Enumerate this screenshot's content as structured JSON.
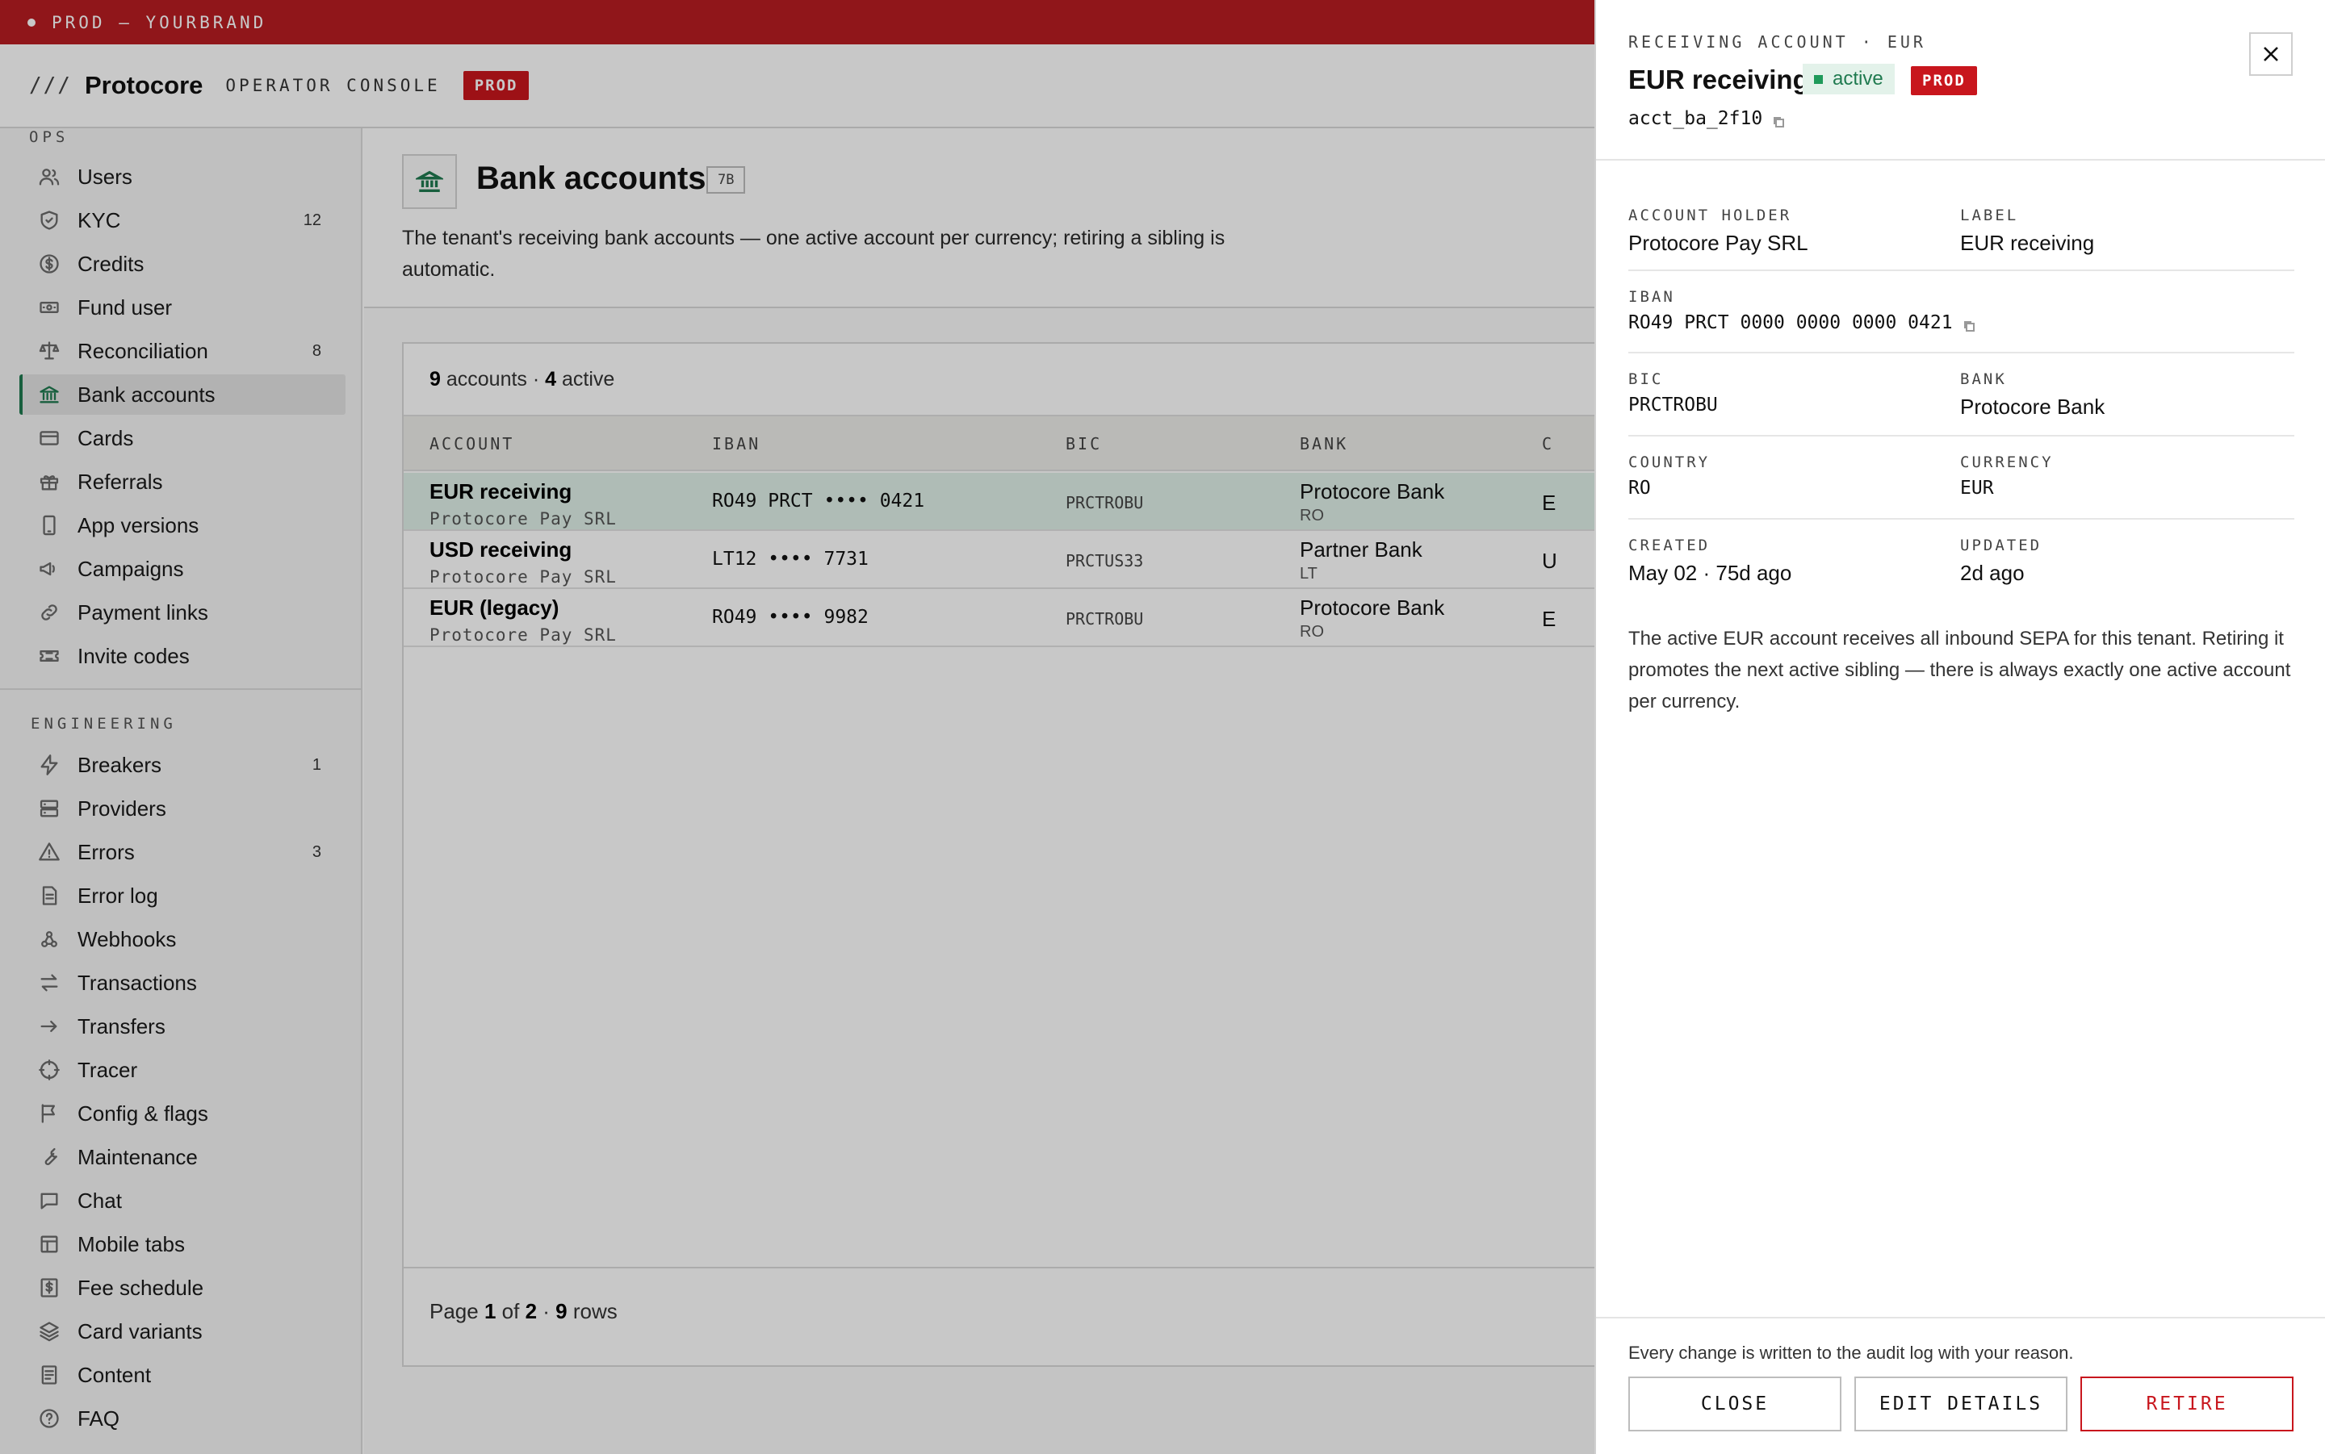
{
  "env_bar": {
    "label": "PROD — YOURBRAND"
  },
  "header": {
    "slashes": "///",
    "brand": "Protocore",
    "console": "OPERATOR CONSOLE",
    "badge": "PROD"
  },
  "sidebar": {
    "ops_label": "OPS",
    "ops_items": [
      {
        "label": "Users",
        "icon": "users-icon",
        "count": ""
      },
      {
        "label": "KYC",
        "icon": "shield-icon",
        "count": "12"
      },
      {
        "label": "Credits",
        "icon": "dollar-circle-icon",
        "count": ""
      },
      {
        "label": "Fund user",
        "icon": "banknote-icon",
        "count": ""
      },
      {
        "label": "Reconciliation",
        "icon": "scale-icon",
        "count": "8"
      },
      {
        "label": "Bank accounts",
        "icon": "bank-icon",
        "count": "",
        "active": true
      },
      {
        "label": "Cards",
        "icon": "card-icon",
        "count": ""
      },
      {
        "label": "Referrals",
        "icon": "gift-icon",
        "count": ""
      },
      {
        "label": "App versions",
        "icon": "phone-icon",
        "count": ""
      },
      {
        "label": "Campaigns",
        "icon": "megaphone-icon",
        "count": ""
      },
      {
        "label": "Payment links",
        "icon": "link-icon",
        "count": ""
      },
      {
        "label": "Invite codes",
        "icon": "ticket-icon",
        "count": ""
      }
    ],
    "eng_label": "ENGINEERING",
    "eng_items": [
      {
        "label": "Breakers",
        "icon": "lightning-icon",
        "count": "1"
      },
      {
        "label": "Providers",
        "icon": "server-icon",
        "count": ""
      },
      {
        "label": "Errors",
        "icon": "warning-icon",
        "count": "3"
      },
      {
        "label": "Error log",
        "icon": "file-icon",
        "count": ""
      },
      {
        "label": "Webhooks",
        "icon": "webhook-icon",
        "count": ""
      },
      {
        "label": "Transactions",
        "icon": "arrows-swap-icon",
        "count": ""
      },
      {
        "label": "Transfers",
        "icon": "arrow-right-icon",
        "count": ""
      },
      {
        "label": "Tracer",
        "icon": "crosshair-icon",
        "count": ""
      },
      {
        "label": "Config & flags",
        "icon": "flag-icon",
        "count": ""
      },
      {
        "label": "Maintenance",
        "icon": "wrench-icon",
        "count": ""
      },
      {
        "label": "Chat",
        "icon": "chat-icon",
        "count": ""
      },
      {
        "label": "Mobile tabs",
        "icon": "layout-icon",
        "count": ""
      },
      {
        "label": "Fee schedule",
        "icon": "dollar-square-icon",
        "count": ""
      },
      {
        "label": "Card variants",
        "icon": "layers-icon",
        "count": ""
      },
      {
        "label": "Content",
        "icon": "document-icon",
        "count": ""
      },
      {
        "label": "FAQ",
        "icon": "help-circle-icon",
        "count": ""
      }
    ]
  },
  "page": {
    "title": "Bank accounts",
    "tag": "7B",
    "description": "The tenant's receiving bank accounts — one active account per currency; retiring a sibling is automatic."
  },
  "table": {
    "summary": {
      "accounts": "9",
      "accounts_label": "accounts ·",
      "active": "4",
      "active_label": "active"
    },
    "columns": [
      "ACCOUNT",
      "IBAN",
      "BIC",
      "BANK",
      "C"
    ],
    "rows": [
      {
        "name": "EUR receiving",
        "holder": "Protocore Pay SRL",
        "iban": "RO49 PRCT •••• 0421",
        "bic": "PRCTROBU",
        "bank": "Protocore Bank",
        "country": "RO",
        "currency": "E",
        "selected": true
      },
      {
        "name": "USD receiving",
        "holder": "Protocore Pay SRL",
        "iban": "LT12 •••• 7731",
        "bic": "PRCTUS33",
        "bank": "Partner Bank",
        "country": "LT",
        "currency": "U"
      },
      {
        "name": "EUR (legacy)",
        "holder": "Protocore Pay SRL",
        "iban": "RO49 •••• 9982",
        "bic": "PRCTROBU",
        "bank": "Protocore Bank",
        "country": "RO",
        "currency": "E"
      }
    ],
    "footer": {
      "page_label": "Page",
      "page": "1",
      "of_label": "of",
      "pages": "2",
      "rows": "9",
      "rows_label": "rows"
    }
  },
  "drawer": {
    "kicker": "RECEIVING ACCOUNT · EUR",
    "title": "EUR receiving",
    "status": "active",
    "badge": "PROD",
    "id": "acct_ba_2f10",
    "fields": {
      "account_holder": {
        "label": "ACCOUNT HOLDER",
        "value": "Protocore Pay SRL"
      },
      "label": {
        "label": "LABEL",
        "value": "EUR receiving"
      },
      "iban": {
        "label": "IBAN",
        "value": "RO49 PRCT 0000 0000 0000 0421"
      },
      "bic": {
        "label": "BIC",
        "value": "PRCTROBU"
      },
      "bank": {
        "label": "BANK",
        "value": "Protocore Bank"
      },
      "country": {
        "label": "COUNTRY",
        "value": "RO"
      },
      "currency": {
        "label": "CURRENCY",
        "value": "EUR"
      },
      "created": {
        "label": "CREATED",
        "value": "May 02 · 75d ago"
      },
      "updated": {
        "label": "UPDATED",
        "value": "2d ago"
      }
    },
    "note": "The active EUR account receives all inbound SEPA for this tenant. Retiring it promotes the next active sibling — there is always exactly one active account per currency.",
    "audit_note": "Every change is written to the audit log with your reason.",
    "buttons": {
      "close": "CLOSE",
      "edit": "EDIT DETAILS",
      "retire": "RETIRE"
    }
  },
  "colors": {
    "accent": "#1f7a4f",
    "prod_red": "#c8161d",
    "env_red": "#b81d22",
    "selected_row": "#dff0e8"
  }
}
